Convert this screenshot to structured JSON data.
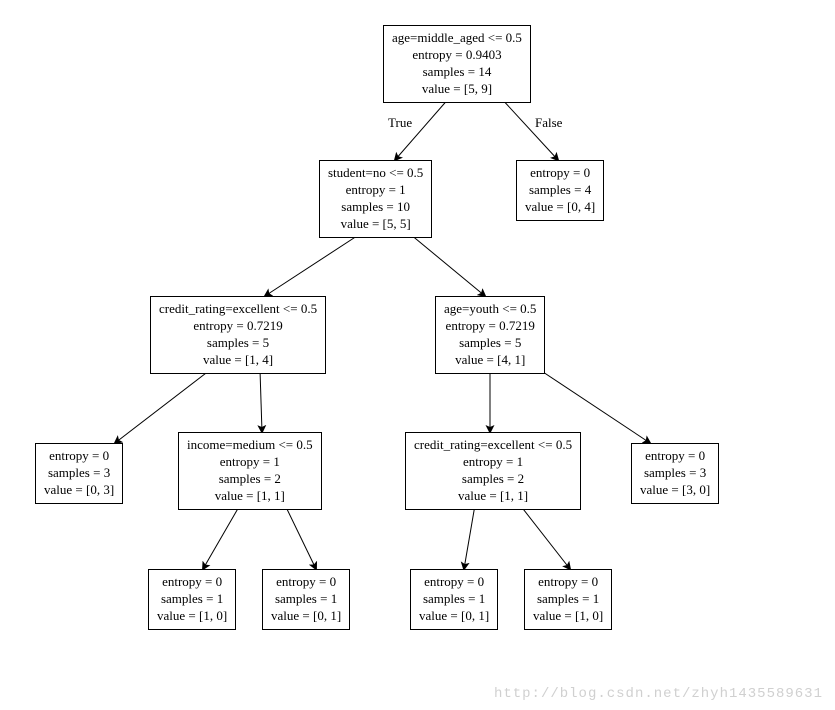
{
  "chart_data": {
    "type": "tree",
    "description": "Decision tree (entropy criterion)",
    "nodes": [
      {
        "id": "n0",
        "condition": "age=middle_aged <= 0.5",
        "entropy": 0.9403,
        "samples": 14,
        "value": [
          5,
          9
        ],
        "left": "n1",
        "right": "n2",
        "left_label": "True",
        "right_label": "False"
      },
      {
        "id": "n1",
        "condition": "student=no <= 0.5",
        "entropy": 1.0,
        "samples": 10,
        "value": [
          5,
          5
        ],
        "left": "n3",
        "right": "n4"
      },
      {
        "id": "n2",
        "entropy": 0.0,
        "samples": 4,
        "value": [
          0,
          4
        ]
      },
      {
        "id": "n3",
        "condition": "credit_rating=excellent <= 0.5",
        "entropy": 0.7219,
        "samples": 5,
        "value": [
          1,
          4
        ],
        "left": "n5",
        "right": "n6"
      },
      {
        "id": "n4",
        "condition": "age=youth <= 0.5",
        "entropy": 0.7219,
        "samples": 5,
        "value": [
          4,
          1
        ],
        "left": "n7",
        "right": "n8"
      },
      {
        "id": "n5",
        "entropy": 0.0,
        "samples": 3,
        "value": [
          0,
          3
        ]
      },
      {
        "id": "n6",
        "condition": "income=medium <= 0.5",
        "entropy": 1.0,
        "samples": 2,
        "value": [
          1,
          1
        ],
        "left": "n9",
        "right": "n10"
      },
      {
        "id": "n7",
        "condition": "credit_rating=excellent <= 0.5",
        "entropy": 1.0,
        "samples": 2,
        "value": [
          1,
          1
        ],
        "left": "n11",
        "right": "n12"
      },
      {
        "id": "n8",
        "entropy": 0.0,
        "samples": 3,
        "value": [
          3,
          0
        ]
      },
      {
        "id": "n9",
        "entropy": 0.0,
        "samples": 1,
        "value": [
          1,
          0
        ]
      },
      {
        "id": "n10",
        "entropy": 0.0,
        "samples": 1,
        "value": [
          0,
          1
        ]
      },
      {
        "id": "n11",
        "entropy": 0.0,
        "samples": 1,
        "value": [
          0,
          1
        ]
      },
      {
        "id": "n12",
        "entropy": 0.0,
        "samples": 1,
        "value": [
          1,
          0
        ]
      }
    ]
  },
  "labels": {
    "entropy_prefix": "entropy = ",
    "samples_prefix": "samples = ",
    "value_prefix": "value = "
  },
  "edge_labels": {
    "true": "True",
    "false": "False"
  },
  "watermark": "http://blog.csdn.net/zhyh1435589631"
}
